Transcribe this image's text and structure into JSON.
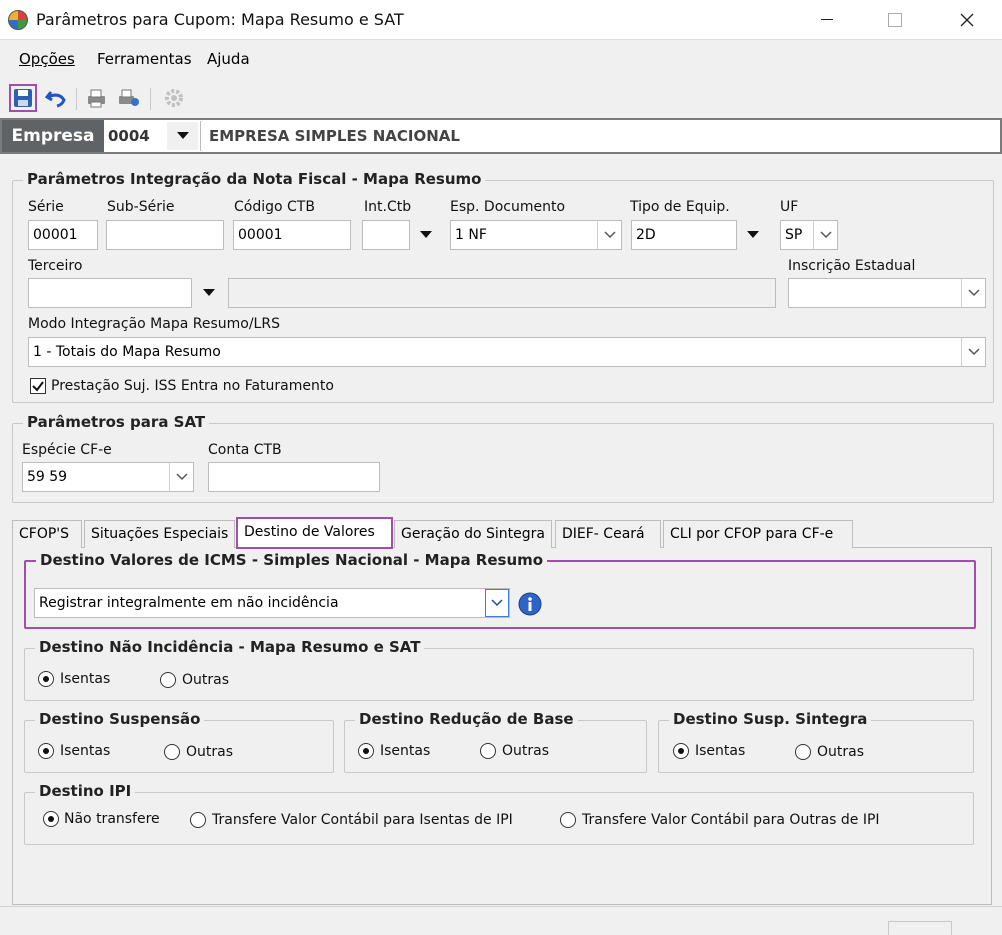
{
  "window": {
    "title": "Parâmetros para Cupom: Mapa Resumo e SAT"
  },
  "menu": {
    "opcoes": "Opções",
    "ferramentas": "Ferramentas",
    "ajuda": "Ajuda"
  },
  "empresa": {
    "label": "Empresa",
    "code": "0004",
    "name": "EMPRESA SIMPLES NACIONAL"
  },
  "nf_group": {
    "title": "Parâmetros Integração da Nota Fiscal - Mapa Resumo",
    "serie": {
      "label": "Série",
      "value": "00001"
    },
    "subserie": {
      "label": "Sub-Série",
      "value": ""
    },
    "codigo_ctb": {
      "label": "Código CTB",
      "value": "00001"
    },
    "int_ctb": {
      "label": "Int.Ctb",
      "value": ""
    },
    "esp_documento": {
      "label": "Esp. Documento",
      "value": "1 NF"
    },
    "tipo_equip": {
      "label": "Tipo de Equip.",
      "value": "2D"
    },
    "uf": {
      "label": "UF",
      "value": "SP"
    },
    "terceiro": {
      "label": "Terceiro",
      "value": ""
    },
    "inscricao_estadual": {
      "label": "Inscrição Estadual",
      "value": ""
    },
    "modo_integracao": {
      "label": "Modo Integração Mapa Resumo/LRS",
      "value": "1 - Totais do Mapa Resumo"
    },
    "prestacao_iss": {
      "label": "Prestação Suj. ISS Entra no Faturamento",
      "checked": true
    }
  },
  "sat_group": {
    "title": "Parâmetros para SAT",
    "especie_cfe": {
      "label": "Espécie CF-e",
      "value": "59 59"
    },
    "conta_ctb": {
      "label": "Conta CTB",
      "value": ""
    }
  },
  "tabs": [
    "CFOP'S",
    "Situações Especiais",
    "Destino de Valores",
    "Geração do Sintegra",
    "DIEF- Ceará",
    "CLI por CFOP para CF-e"
  ],
  "destino": {
    "icms": {
      "title": "Destino Valores de ICMS - Simples Nacional - Mapa Resumo",
      "value": "Registrar integralmente em não incidência"
    },
    "nao_incidencia": {
      "title": "Destino Não Incidência - Mapa Resumo e SAT",
      "isentas": "Isentas",
      "outras": "Outras"
    },
    "suspensao": {
      "title": "Destino Suspensão",
      "isentas": "Isentas",
      "outras": "Outras"
    },
    "reducao": {
      "title": "Destino Redução de Base",
      "isentas": "Isentas",
      "outras": "Outras"
    },
    "susp_sintegra": {
      "title": "Destino Susp. Sintegra",
      "isentas": "Isentas",
      "outras": "Outras"
    },
    "ipi": {
      "title": "Destino IPI",
      "nao_transfere": "Não transfere",
      "isentas": "Transfere Valor Contábil para Isentas de IPI",
      "outras": "Transfere Valor Contábil para Outras de IPI"
    }
  },
  "colors": {
    "highlight": "#a04fa8",
    "empresa_bg": "#5f6365"
  }
}
